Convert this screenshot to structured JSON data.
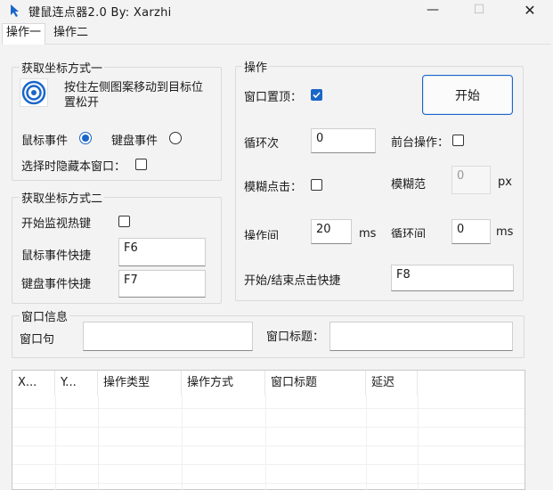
{
  "window": {
    "title": "键鼠连点器2.0 By:  Xarzhi",
    "minimize_glyph": "—",
    "maximize_glyph": "☐",
    "close_glyph": "✕"
  },
  "tabs": [
    {
      "label": "操作一",
      "active": true
    },
    {
      "label": "操作二",
      "active": false
    }
  ],
  "group1": {
    "title": "获取坐标方式一",
    "target_icon": "target-icon",
    "instruction": "按住左侧图案移动到目标位置松开",
    "mouse_event_label": "鼠标事件",
    "mouse_event_checked": true,
    "keyboard_event_label": "键盘事件",
    "keyboard_event_checked": false,
    "hide_window_label": "选择时隐藏本窗口：",
    "hide_window_checked": false
  },
  "group2": {
    "title": "获取坐标方式二",
    "start_hotkey_label": "开始监视热键",
    "start_hotkey_checked": false,
    "mouse_shortcut_label": "鼠标事件快捷",
    "mouse_shortcut_value": "F6",
    "keyboard_shortcut_label": "键盘事件快捷",
    "keyboard_shortcut_value": "F7"
  },
  "operation": {
    "title": "操作",
    "topmost_label": "窗口置顶：",
    "topmost_checked": true,
    "start_button": "开始",
    "loop_count_label": "循环次",
    "loop_count_value": "0",
    "foreground_label": "前台操作：",
    "foreground_checked": false,
    "fuzzy_click_label": "模糊点击：",
    "fuzzy_click_checked": false,
    "fuzzy_range_label": "模糊范",
    "fuzzy_range_value": "0",
    "fuzzy_range_unit": "px",
    "interval_label": "操作间",
    "interval_value": "20",
    "interval_unit": "ms",
    "loop_interval_label": "循环间",
    "loop_interval_value": "0",
    "loop_interval_unit": "ms",
    "start_stop_shortcut_label": "开始/结束点击快捷",
    "start_stop_shortcut_value": "F8"
  },
  "window_info": {
    "title": "窗口信息",
    "handle_label": "窗口句",
    "handle_value": "",
    "window_title_label": "窗口标题：",
    "window_title_value": ""
  },
  "table": {
    "columns": [
      "X...",
      "Y...",
      "操作类型",
      "操作方式",
      "窗口标题",
      "延迟"
    ]
  },
  "colors": {
    "accent": "#1a66c9",
    "background": "#f3f3f3"
  }
}
